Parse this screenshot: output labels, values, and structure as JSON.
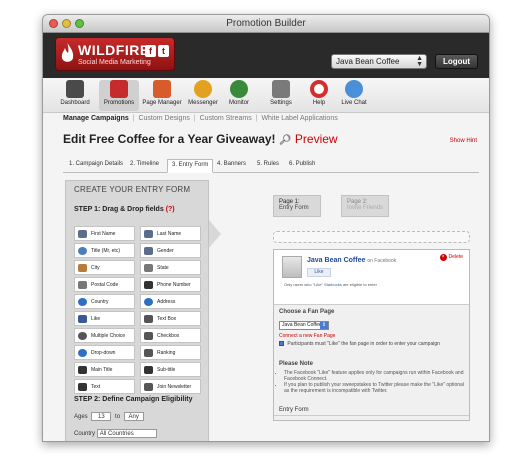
{
  "window": {
    "title": "Promotion Builder"
  },
  "brand": {
    "name": "WILDFIRE",
    "tagline": "Social Media Marketing",
    "social": [
      "f",
      "t"
    ]
  },
  "account": {
    "selected": "Java Bean Coffee",
    "logout": "Logout"
  },
  "toolbar": {
    "items": [
      {
        "label": "Dashboard",
        "icon": "dashboard-icon",
        "color": "#4a4a4a"
      },
      {
        "label": "Promotions",
        "icon": "promotions-icon",
        "color": "#c62b2b"
      },
      {
        "label": "Page Manager",
        "icon": "page-manager-icon",
        "color": "#d85c2b"
      },
      {
        "label": "Messenger",
        "icon": "messenger-icon",
        "color": "#e2a220"
      },
      {
        "label": "Monitor",
        "icon": "monitor-icon",
        "color": "#3b8a3b"
      },
      {
        "label": "Settings",
        "icon": "settings-icon",
        "color": "#7a7a7a"
      },
      {
        "label": "Help",
        "icon": "help-icon",
        "color": "#d32f2f"
      },
      {
        "label": "Live Chat",
        "icon": "live-chat-icon",
        "color": "#4a90d9"
      }
    ]
  },
  "subnav": {
    "items": [
      "Manage Campaigns",
      "Custom Designs",
      "Custom Streams",
      "White Label Applications"
    ]
  },
  "page": {
    "title": "Edit Free Coffee for a Year Giveaway!",
    "preview": "Preview",
    "show_hint": "Show Hint"
  },
  "tabs": [
    "1. Campaign Details",
    "2. Timeline",
    "3. Entry Form",
    "4. Banners",
    "5. Rules",
    "6. Publish"
  ],
  "left": {
    "title": "CREATE YOUR ENTRY FORM",
    "step1": "STEP 1: Drag & Drop fields",
    "step1_hint": "(?)",
    "fields": [
      {
        "label": "First Name",
        "icon": "person-icon",
        "color": "#5a6e8c"
      },
      {
        "label": "Last Name",
        "icon": "person-icon",
        "color": "#5a6e8c"
      },
      {
        "label": "Title (Mr, etc)",
        "icon": "speech-icon",
        "color": "#4a7ebb"
      },
      {
        "label": "Gender",
        "icon": "gender-icon",
        "color": "#5a6e8c"
      },
      {
        "label": "City",
        "icon": "city-icon",
        "color": "#b97a3a"
      },
      {
        "label": "State",
        "icon": "state-icon",
        "color": "#777777"
      },
      {
        "label": "Postal Code",
        "icon": "postal-code-icon",
        "color": "#777777"
      },
      {
        "label": "Phone Number",
        "icon": "phone-icon",
        "color": "#333333"
      },
      {
        "label": "Country",
        "icon": "globe-icon",
        "color": "#2f6fc0"
      },
      {
        "label": "Address",
        "icon": "address-icon",
        "color": "#2f6fc0"
      },
      {
        "label": "Like",
        "icon": "thumb-icon",
        "color": "#3b5998"
      },
      {
        "label": "Text Box",
        "icon": "text-box-icon",
        "color": "#555555"
      },
      {
        "label": "Multiple Choice",
        "icon": "multiple-choice-icon",
        "color": "#555555"
      },
      {
        "label": "Checkbox",
        "icon": "checkbox-icon",
        "color": "#555555"
      },
      {
        "label": "Drop-down",
        "icon": "dropdown-icon",
        "color": "#2f6fc0"
      },
      {
        "label": "Ranking",
        "icon": "ranking-icon",
        "color": "#555555"
      },
      {
        "label": "Main Title",
        "icon": "main-title-icon",
        "color": "#333333"
      },
      {
        "label": "Sub-title",
        "icon": "sub-title-icon",
        "color": "#333333"
      },
      {
        "label": "Text",
        "icon": "text-icon",
        "color": "#333333"
      },
      {
        "label": "Join Newsletter",
        "icon": "newsletter-icon",
        "color": "#555555"
      }
    ],
    "step2": "STEP 2: Define Campaign Eligibility",
    "ages_label": "Ages",
    "age_from": "13",
    "age_to_label": "to",
    "age_to": "Any",
    "country_label": "Country",
    "country": "All Countries"
  },
  "pages": [
    {
      "title": "Page 1:",
      "sub": "Entry Form"
    },
    {
      "title": "Page 2:",
      "sub": "Invite Friends"
    }
  ],
  "card": {
    "name": "Java Bean Coffee",
    "on": "on Facebook",
    "like": "Like",
    "note_prefix": "Only users who \"Like\" ",
    "note_link": "Starbucks",
    "note_suffix": " are eligible to enter",
    "delete": "Delete"
  },
  "fanpage": {
    "label": "Choose a Fan Page",
    "selected": "Java Bean Coffee",
    "connect": "Connect a new Fan Page",
    "must_like": "Participants must \"Like\" the fan page in order to enter your campaign"
  },
  "note": {
    "title": "Please Note",
    "items": [
      "The Facebook \"Like\" feature applies only for campaigns run within Facebook and Facebook Connect.",
      "If you plan to publish your sweepstakes to Twitter please make the \"Like\" optional as the requirement is incompatible with Twitter."
    ]
  },
  "entry": {
    "label": "Entry Form"
  },
  "colors": {
    "accent": "#c62b2b",
    "link": "#cc0000",
    "facebook": "#3b5998"
  }
}
